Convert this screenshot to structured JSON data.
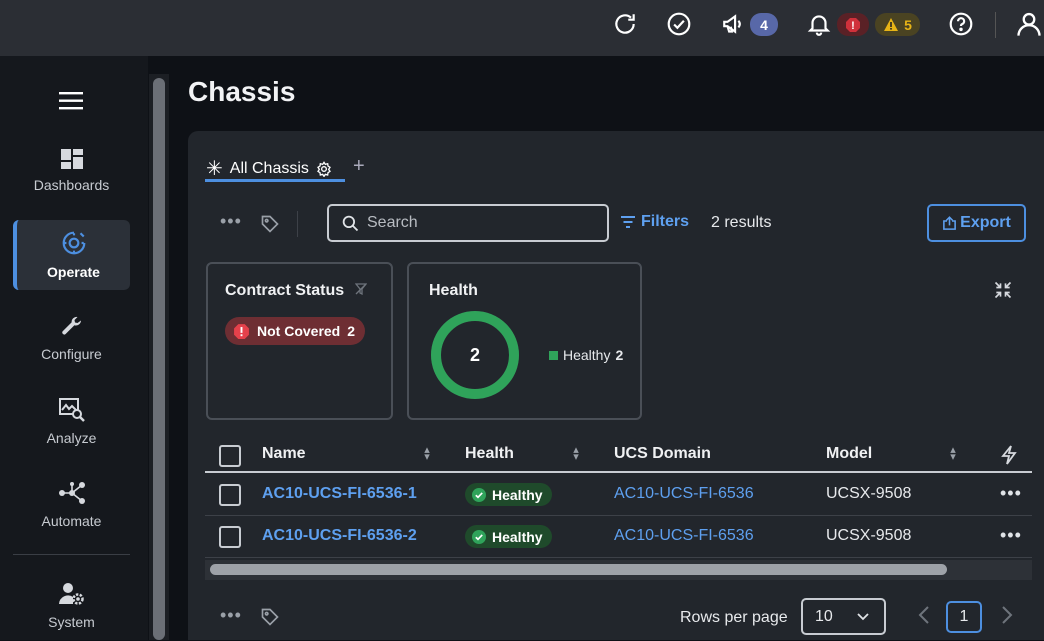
{
  "topbar": {
    "announcements_count": "4",
    "critical_alarm_icon": "!",
    "warning_count": "5",
    "colors": {
      "critical": "#d0313b",
      "warning": "#e7b416",
      "info": "#5868a8"
    }
  },
  "sidebar": {
    "items": [
      {
        "label": "Dashboards",
        "icon": "dashboard-icon"
      },
      {
        "label": "Operate",
        "icon": "operate-icon",
        "active": true
      },
      {
        "label": "Configure",
        "icon": "wrench-icon"
      },
      {
        "label": "Analyze",
        "icon": "analyze-icon"
      },
      {
        "label": "Automate",
        "icon": "workflow-icon"
      },
      {
        "label": "System",
        "icon": "system-icon"
      }
    ]
  },
  "page": {
    "title": "Chassis"
  },
  "tabs": {
    "active_label": "All Chassis"
  },
  "toolbar": {
    "search_placeholder": "Search",
    "filters_label": "Filters",
    "results_text": "2 results",
    "export_label": "Export"
  },
  "cards": {
    "contract": {
      "title": "Contract Status",
      "pill_label": "Not Covered",
      "pill_count": "2"
    },
    "health": {
      "title": "Health",
      "total": "2",
      "legend_label": "Healthy",
      "legend_count": "2",
      "healthy_fraction": 1.0,
      "color": "#2fa35a"
    }
  },
  "table": {
    "columns": [
      "Name",
      "Health",
      "UCS Domain",
      "Model"
    ],
    "rows": [
      {
        "name": "AC10-UCS-FI-6536-1",
        "health": "Healthy",
        "domain": "AC10-UCS-FI-6536",
        "model": "UCSX-9508"
      },
      {
        "name": "AC10-UCS-FI-6536-2",
        "health": "Healthy",
        "domain": "AC10-UCS-FI-6536",
        "model": "UCSX-9508"
      }
    ]
  },
  "pagination": {
    "rows_per_page_label": "Rows per page",
    "rows_per_page_value": "10",
    "current_page": "1"
  }
}
